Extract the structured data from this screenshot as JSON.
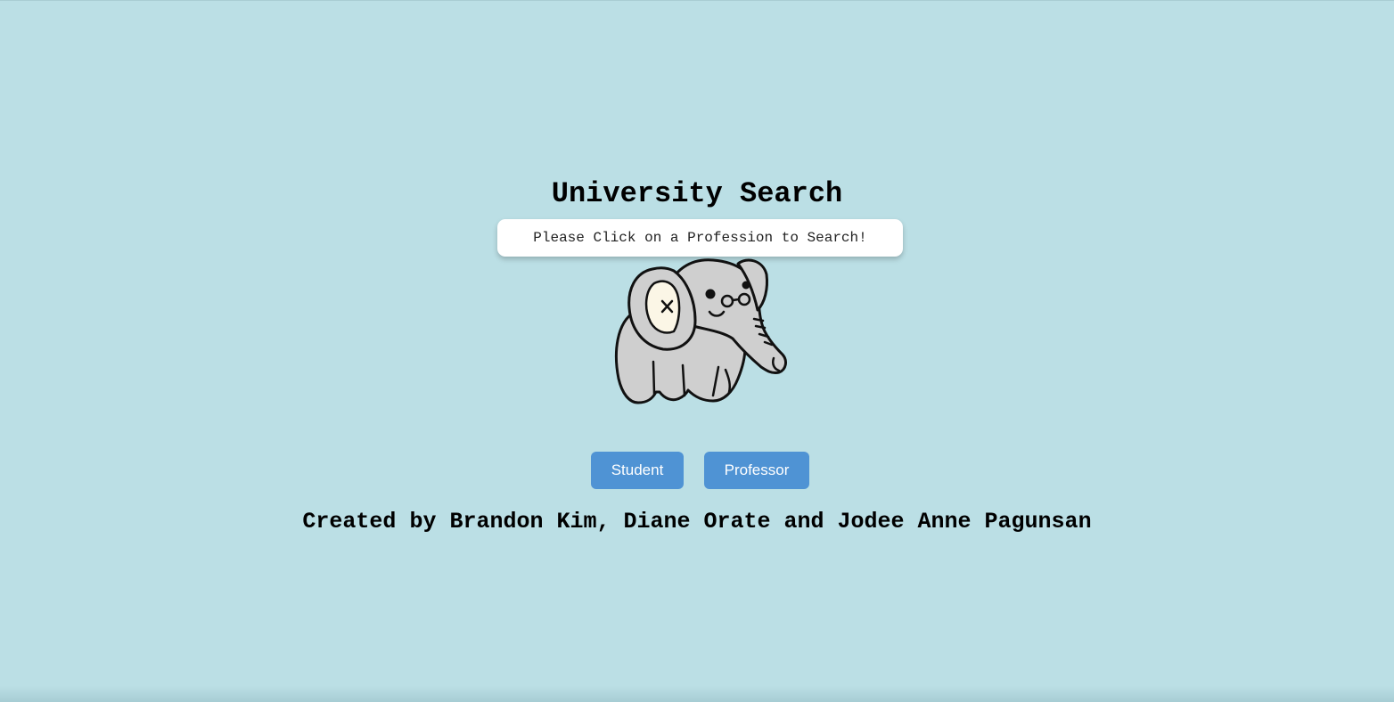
{
  "page": {
    "title": "University Search",
    "prompt": "Please Click on a Profession to Search!",
    "mascot_icon": "elephant-with-glasses-icon",
    "background_color": "#bbdfe5"
  },
  "buttons": {
    "student_label": "Student",
    "professor_label": "Professor",
    "color": "#4f93d4"
  },
  "footer": {
    "credits": "Created by Brandon Kim, Diane Orate and Jodee Anne Pagunsan"
  }
}
